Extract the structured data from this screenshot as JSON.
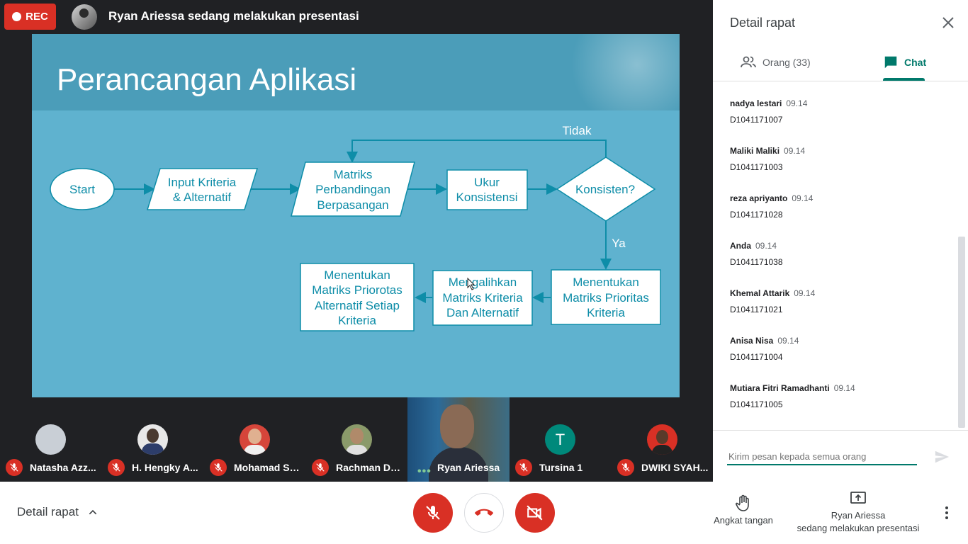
{
  "topbar": {
    "rec_label": "REC",
    "presenter_text": "Ryan Ariessa sedang melakukan presentasi"
  },
  "slide": {
    "title": "Perancangan Aplikasi",
    "nodes": {
      "start": "Start",
      "input_l1": "Input Kriteria",
      "input_l2": "& Alternatif",
      "matriks_l1": "Matriks",
      "matriks_l2": "Perbandingan",
      "matriks_l3": "Berpasangan",
      "ukur_l1": "Ukur",
      "ukur_l2": "Konsistensi",
      "konsisten": "Konsisten?",
      "tidak": "Tidak",
      "ya": "Ya",
      "prioritas_l1": "Menentukan",
      "prioritas_l2": "Matriks Prioritas",
      "prioritas_l3": "Kriteria",
      "mengalihkan_l1": "Mengalihkan",
      "mengalihkan_l2": "Matriks Kriteria",
      "mengalihkan_l3": "Dan Alternatif",
      "alt_l1": "Menentukan",
      "alt_l2": "Matriks Priorotas",
      "alt_l3": "Alternatif Setiap",
      "alt_l4": "Kriteria"
    }
  },
  "participants": [
    {
      "name": "Natasha Azz...",
      "avatar_color": "#c9cfd6"
    },
    {
      "name": "H. Hengky A...",
      "avatar_color": "#e8e8e8"
    },
    {
      "name": "Mohamad Sy...",
      "avatar_color": "#d6453a"
    },
    {
      "name": "Rachman Dw...",
      "avatar_color": "#8a9a6a"
    },
    {
      "name": "Tursina 1",
      "avatar_color": "#00897b",
      "initial": "T"
    },
    {
      "name": "DWIKI SYAH...",
      "avatar_color": "#d93025"
    }
  ],
  "presenter_tile": {
    "name": "Ryan Ariessa",
    "dots": "•••"
  },
  "panel": {
    "title": "Detail rapat",
    "tab_people": "Orang (33)",
    "tab_chat": "Chat",
    "messages": [
      {
        "sender": "nadya lestari",
        "time": "09.14",
        "text": "D1041171007"
      },
      {
        "sender": "Maliki Maliki",
        "time": "09.14",
        "text": "D1041171003"
      },
      {
        "sender": "reza apriyanto",
        "time": "09.14",
        "text": "D1041171028"
      },
      {
        "sender": "Anda",
        "time": "09.14",
        "text": "D1041171038"
      },
      {
        "sender": "Khemal Attarik",
        "time": "09.14",
        "text": "D1041171021"
      },
      {
        "sender": "Anisa Nisa",
        "time": "09.14",
        "text": "D1041171004"
      },
      {
        "sender": "Mutiara Fitri Ramadhanti",
        "time": "09.14",
        "text": "D1041171005"
      }
    ],
    "input_placeholder": "Kirim pesan kepada semua orang"
  },
  "bottombar": {
    "details_label": "Detail rapat",
    "raise_hand_label": "Angkat tangan",
    "present_line1": "Ryan Ariessa",
    "present_line2": "sedang melakukan presentasi"
  },
  "colors": {
    "accent": "#00796b",
    "danger": "#d93025",
    "slide_bg": "#5fb2cf"
  }
}
